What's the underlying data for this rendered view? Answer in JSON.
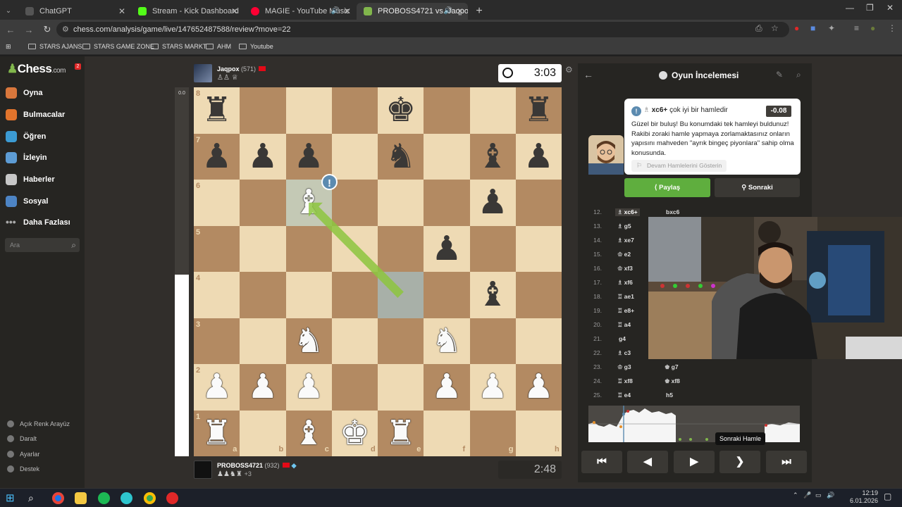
{
  "browser": {
    "tabs": [
      {
        "label": "ChatGPT",
        "color": "#4a4a4a"
      },
      {
        "label": "Stream - Kick Dashboard",
        "color": "#53fc18"
      },
      {
        "label": "MAGIE - YouTube Music",
        "color": "#ff0033"
      },
      {
        "label": "PROBOSS4721 vs. Jaqpox |",
        "color": "#81b64c"
      }
    ],
    "url": "chess.com/analysis/game/live/147652487588/review?move=22",
    "bookmarks": [
      "STARS AJANS",
      "STARS GAME ZONE",
      "STARS MARKT",
      "AHM",
      "Youtube"
    ]
  },
  "sidebar": {
    "logo": "Chess",
    "logo_suffix": ".com",
    "notification_count": "2",
    "items": [
      {
        "label": "Oyna",
        "color": "#d9773c"
      },
      {
        "label": "Bulmacalar",
        "color": "#e2742c"
      },
      {
        "label": "Öğren",
        "color": "#3c9bd3"
      },
      {
        "label": "İzleyin",
        "color": "#5d9cd4"
      },
      {
        "label": "Haberler",
        "color": "#c7c7c7"
      },
      {
        "label": "Sosyal",
        "color": "#4d84c4"
      },
      {
        "label": "Daha Fazlası",
        "color": "#999999"
      }
    ],
    "search_placeholder": "Ara",
    "bottom_items": [
      "Açık Renk Arayüz",
      "Daralt",
      "Ayarlar",
      "Destek"
    ]
  },
  "game": {
    "eval_score": "0.0",
    "top_player": {
      "name": "Jaqpox",
      "rating": "(571)",
      "captured": "♙♙ ♕"
    },
    "bottom_player": {
      "name": "PROBOSS4721",
      "rating": "(932)",
      "captured": "♟♟♞♜",
      "captured_extra": "+3"
    },
    "top_clock": "3:03",
    "bottom_clock": "2:48",
    "files": [
      "a",
      "b",
      "c",
      "d",
      "e",
      "f",
      "g",
      "h"
    ],
    "ranks": [
      "8",
      "7",
      "6",
      "5",
      "4",
      "3",
      "2",
      "1"
    ],
    "position": [
      [
        "r",
        "",
        "",
        "",
        "k",
        "",
        "",
        "r"
      ],
      [
        "p",
        "p",
        "p",
        "",
        "n",
        "",
        "b",
        "p"
      ],
      [
        "",
        "",
        "B",
        "",
        "",
        "",
        "p",
        ""
      ],
      [
        "",
        "",
        "",
        "",
        "",
        "p",
        "",
        ""
      ],
      [
        "",
        "",
        "",
        "",
        "",
        "",
        "b",
        ""
      ],
      [
        "",
        "",
        "N",
        "",
        "",
        "N",
        "",
        ""
      ],
      [
        "P",
        "P",
        "P",
        "",
        "",
        "P",
        "P",
        "P"
      ],
      [
        "R",
        "",
        "B",
        "K",
        "R",
        "",
        "",
        ""
      ]
    ],
    "last_move_from": "e4",
    "last_move_to": "c6",
    "colors": {
      "light": "#eedab4",
      "dark": "#b38a62",
      "arrow": "#8dc63f",
      "brilliant": "#5c8bb0"
    }
  },
  "review": {
    "title": "Oyun İncelemesi",
    "coach_move": "xc6+",
    "coach_verdict": "çok iyi bir hamledir",
    "eval": "-0.08",
    "coach_text": "Güzel bir buluş! Bu konumdaki tek hamleyi buldunuz! Rakibi zoraki hamle yapmaya zorlamaktasınız onların yapısını mahveden \"ayrık bingeç piyonlara\" sahip olma konusunda.",
    "show_moves": "Devam Hamlelerini Gösterin",
    "share_label": "Paylaş",
    "next_label": "Sonraki",
    "moves": [
      {
        "n": "12.",
        "w": "xc6+",
        "wp": "♗",
        "b": "bxc6",
        "bp": "",
        "current": true
      },
      {
        "n": "13.",
        "w": "g5",
        "wp": "♗",
        "b": "",
        "bp": ""
      },
      {
        "n": "14.",
        "w": "xe7",
        "wp": "♗",
        "b": "",
        "bp": ""
      },
      {
        "n": "15.",
        "w": "e2",
        "wp": "♔",
        "b": "",
        "bp": ""
      },
      {
        "n": "16.",
        "w": "xf3",
        "wp": "♔",
        "b": "",
        "bp": ""
      },
      {
        "n": "17.",
        "w": "xf6",
        "wp": "♗",
        "b": "",
        "bp": ""
      },
      {
        "n": "18.",
        "w": "ae1",
        "wp": "♖",
        "b": "",
        "bp": ""
      },
      {
        "n": "19.",
        "w": "e8+",
        "wp": "♖",
        "b": "",
        "bp": ""
      },
      {
        "n": "20.",
        "w": "a4",
        "wp": "♖",
        "b": "",
        "bp": ""
      },
      {
        "n": "21.",
        "w": "g4",
        "wp": "",
        "b": "",
        "bp": ""
      },
      {
        "n": "22.",
        "w": "c3",
        "wp": "♗",
        "b": "",
        "bp": ""
      },
      {
        "n": "23.",
        "w": "g3",
        "wp": "♔",
        "b": "g7",
        "bp": "♚"
      },
      {
        "n": "24.",
        "w": "xf8",
        "wp": "♖",
        "b": "xf8",
        "bp": "♚"
      },
      {
        "n": "25.",
        "w": "e4",
        "wp": "♖",
        "b": "h5",
        "bp": ""
      }
    ],
    "tooltip": "Sonraki Hamle",
    "controls": [
      "⏮",
      "◀",
      "▶",
      "❯",
      "⏭"
    ]
  },
  "taskbar": {
    "time": "12:19",
    "date": "6.01.2026"
  }
}
